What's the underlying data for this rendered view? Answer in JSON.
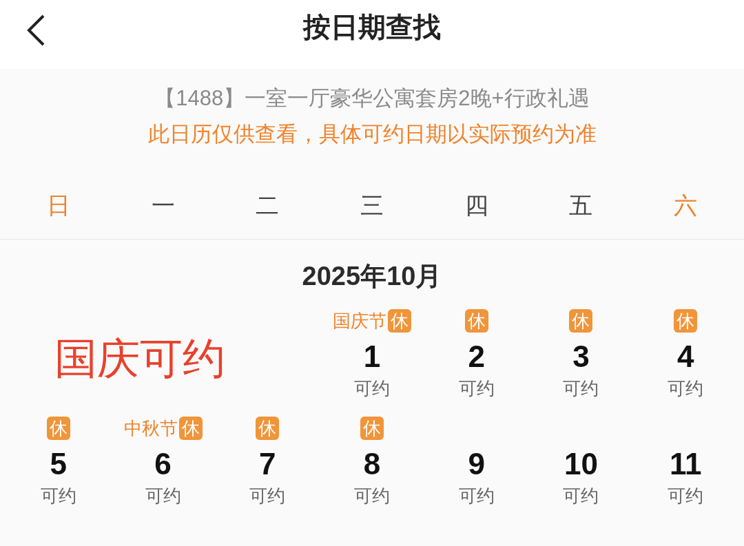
{
  "header": {
    "title": "按日期查找"
  },
  "product": "【1488】一室一厅豪华公寓套房2晚+行政礼遇",
  "notice": "此日历仅供查看，具体可约日期以实际预约为准",
  "weekdays": [
    {
      "label": "日",
      "weekend": true
    },
    {
      "label": "一",
      "weekend": false
    },
    {
      "label": "二",
      "weekend": false
    },
    {
      "label": "三",
      "weekend": false
    },
    {
      "label": "四",
      "weekend": false
    },
    {
      "label": "五",
      "weekend": false
    },
    {
      "label": "六",
      "weekend": true
    }
  ],
  "month": "2025年10月",
  "annotation": "国庆可约",
  "days": [
    {
      "day": "1",
      "status": "可约",
      "holiday": "国庆节",
      "rest_badge": "休"
    },
    {
      "day": "2",
      "status": "可约",
      "rest_badge": "休"
    },
    {
      "day": "3",
      "status": "可约",
      "rest_badge": "休"
    },
    {
      "day": "4",
      "status": "可约",
      "rest_badge": "休"
    },
    {
      "day": "5",
      "status": "可约",
      "rest_badge": "休"
    },
    {
      "day": "6",
      "status": "可约",
      "holiday": "中秋节",
      "rest_badge": "休"
    },
    {
      "day": "7",
      "status": "可约",
      "rest_badge": "休"
    },
    {
      "day": "8",
      "status": "可约",
      "rest_badge": "休"
    },
    {
      "day": "9",
      "status": "可约"
    },
    {
      "day": "10",
      "status": "可约"
    },
    {
      "day": "11",
      "status": "可约"
    }
  ]
}
